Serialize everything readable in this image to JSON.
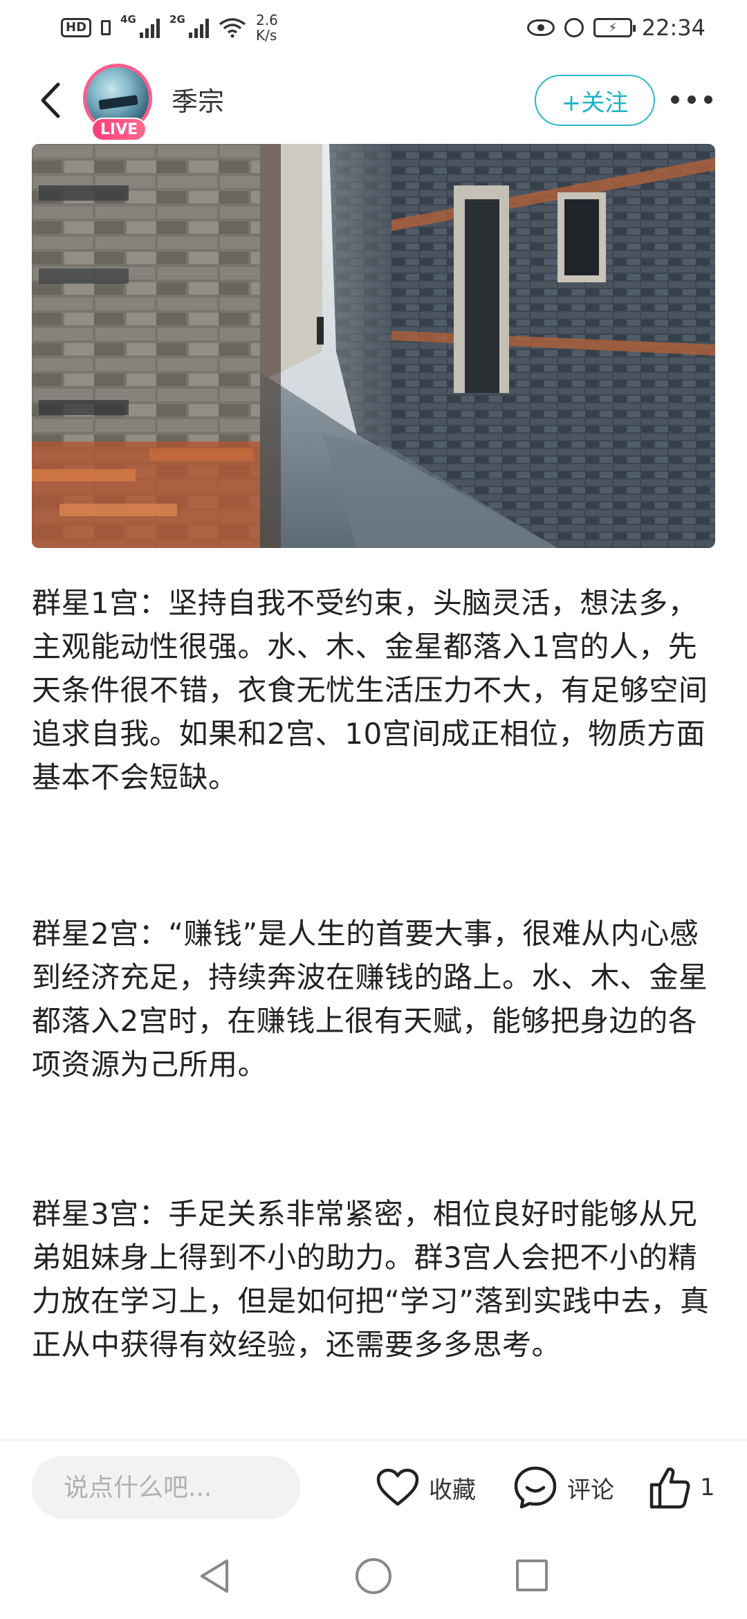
{
  "status_bar": {
    "hd": "HD",
    "sim1": "4G",
    "sim2": "2G",
    "speed_value": "2.6",
    "speed_unit": "K/s",
    "time": "22:34"
  },
  "header": {
    "author_name": "季宗",
    "live_label": "LIVE",
    "follow_label": "+关注"
  },
  "article": {
    "paragraphs": [
      "群星1宫：坚持自我不受约束，头脑灵活，想法多，主观能动性很强。水、木、金星都落入1宫的人，先天条件很不错，衣食无忧生活压力不大，有足够空间追求自我。如果和2宫、10宫间成正相位，物质方面基本不会短缺。",
      "群星2宫：“赚钱”是人生的首要大事，很难从内心感到经济充足，持续奔波在赚钱的路上。水、木、金星都落入2宫时，在赚钱上很有天赋，能够把身边的各项资源为己所用。",
      "群星3宫：手足关系非常紧密，相位良好时能够从兄弟姐妹身上得到不小的助力。群3宫人会把不小的精力放在学习上，但是如何把“学习”落到实践中去，真正从中获得有效经验，还需要多多思考。"
    ]
  },
  "bottom_bar": {
    "comment_placeholder": "说点什么吧...",
    "favorite_label": "收藏",
    "comment_label": "评论",
    "like_count": "1"
  },
  "colors": {
    "accent": "#1fb2c4",
    "live_badge": "#ff3c7a"
  },
  "icons": {
    "back": "back-chevron-icon",
    "more": "more-dots-icon",
    "favorite": "heart-icon",
    "comment": "speech-bubble-icon",
    "like": "thumbs-up-icon"
  }
}
